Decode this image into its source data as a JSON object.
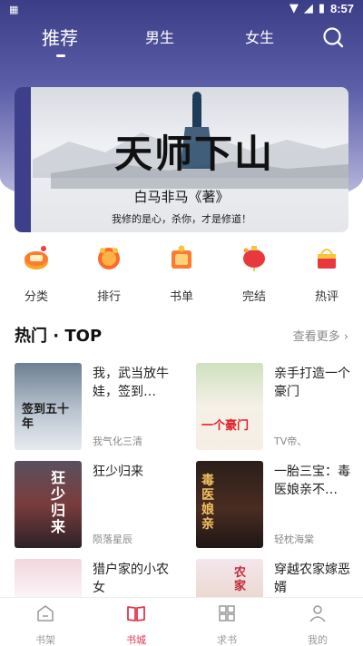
{
  "status_bar": {
    "time": "8:57"
  },
  "top_tabs": [
    {
      "label": "推荐",
      "active": true
    },
    {
      "label": "男生",
      "active": false
    },
    {
      "label": "女生",
      "active": false
    }
  ],
  "banner": {
    "title": "天师下山",
    "author": "白马非马《著》",
    "tagline": "我修的是心，杀你，才是修道！"
  },
  "categories": [
    {
      "label": "分类",
      "icon": "category-icon"
    },
    {
      "label": "排行",
      "icon": "ranking-icon"
    },
    {
      "label": "书单",
      "icon": "booklist-icon"
    },
    {
      "label": "完结",
      "icon": "completed-icon"
    },
    {
      "label": "热评",
      "icon": "hot-comment-icon"
    }
  ],
  "section": {
    "title": "热门 · TOP",
    "see_more": "查看更多"
  },
  "books": [
    {
      "title": "我，武当放牛娃，签到…",
      "author": "我气化三清",
      "cover_text": "签到五十年"
    },
    {
      "title": "亲手打造一个豪门",
      "author": "TV帝、",
      "cover_text": "一个豪门"
    },
    {
      "title": "狂少归来",
      "author": "陨落星辰",
      "cover_text": "狂少归来"
    },
    {
      "title": "一胎三宝：毒医娘亲不…",
      "author": "轻枕海棠",
      "cover_text": "毒医娘亲"
    },
    {
      "title": "猎户家的小农女",
      "author": "",
      "cover_text": ""
    },
    {
      "title": "穿越农家嫁恶婿",
      "author": "",
      "cover_text": "农家"
    }
  ],
  "bottom_nav": [
    {
      "label": "书架",
      "active": false
    },
    {
      "label": "书城",
      "active": true
    },
    {
      "label": "求书",
      "active": false
    },
    {
      "label": "我的",
      "active": false
    }
  ],
  "colors": {
    "accent": "#e0374f",
    "header": "#4a4c98"
  }
}
